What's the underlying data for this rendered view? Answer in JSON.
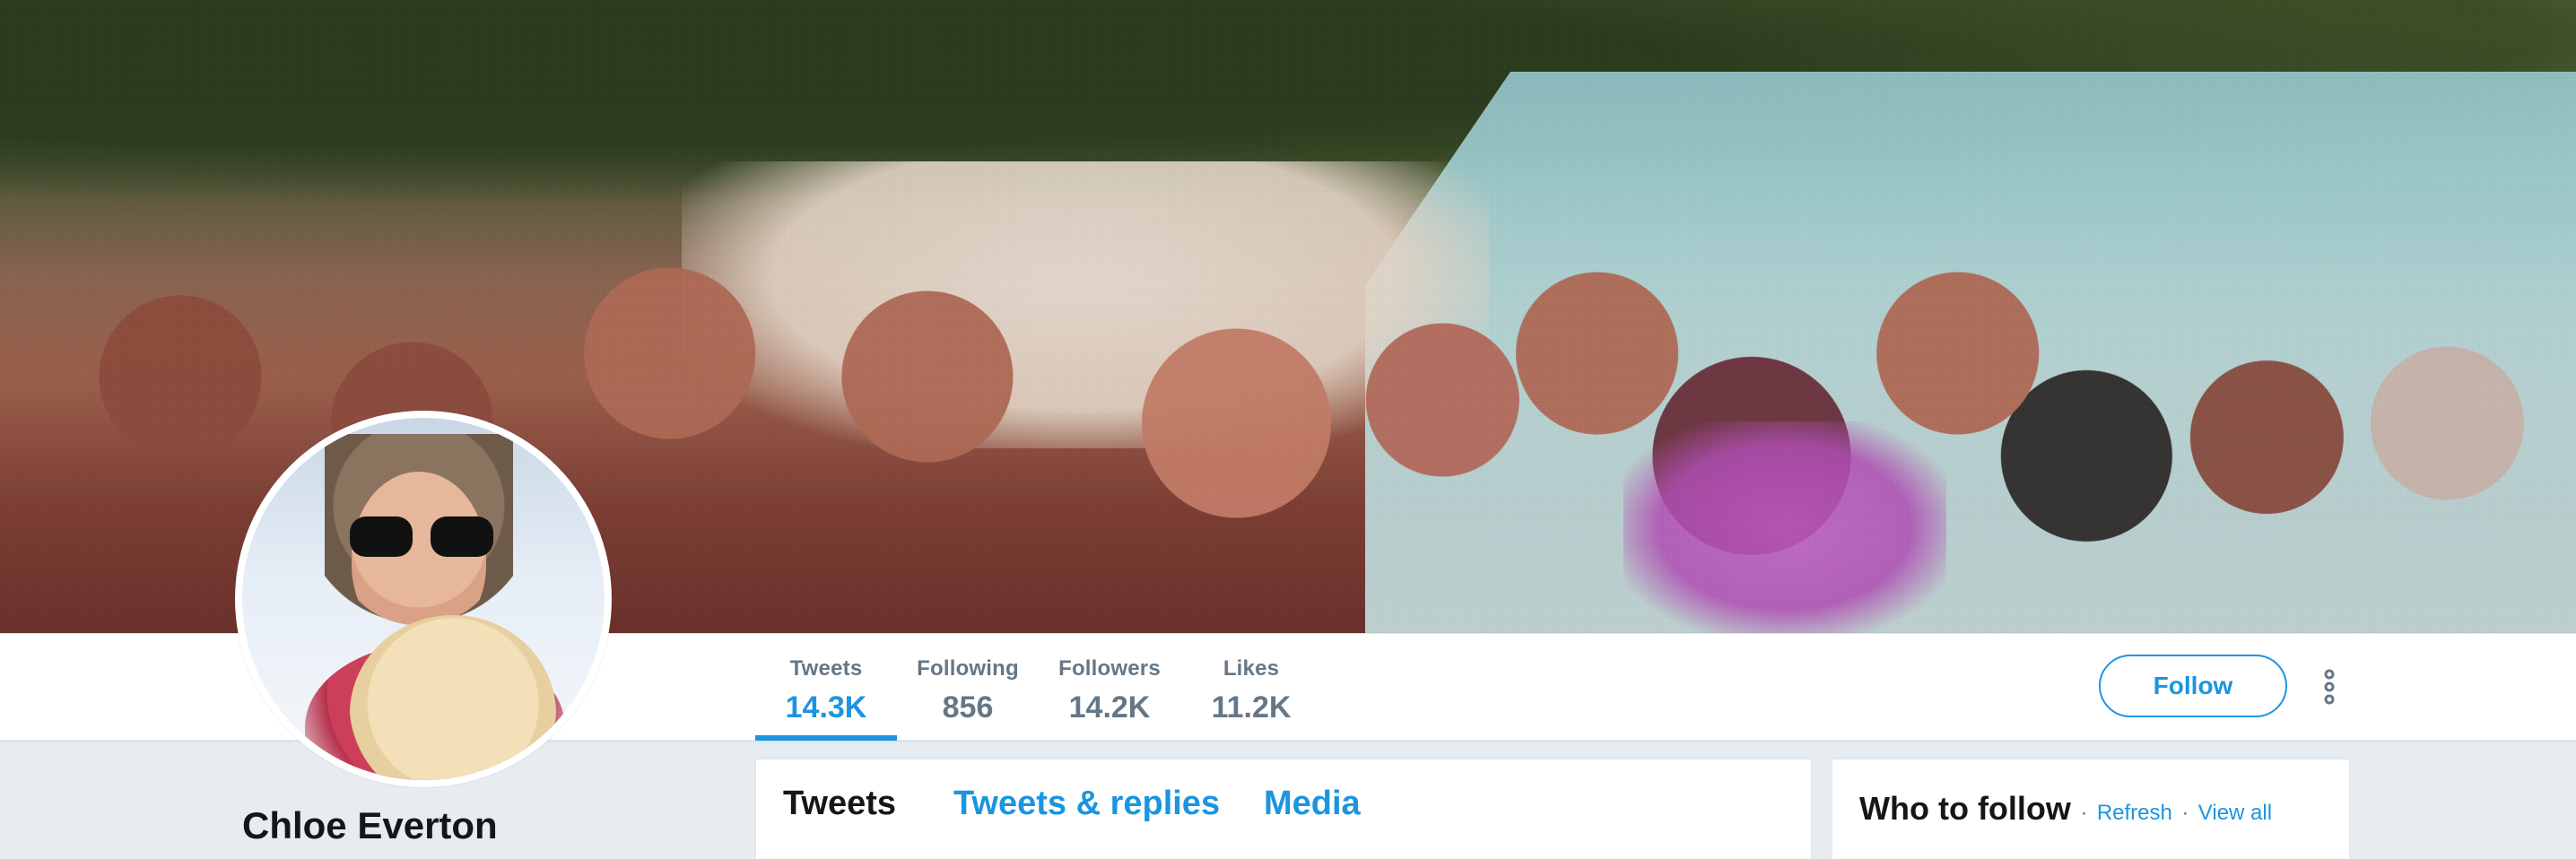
{
  "profile": {
    "name": "Chloe Everton"
  },
  "banner": {
    "description_icon": "banner-photo"
  },
  "stats": [
    {
      "label": "Tweets",
      "value": "14.3K",
      "active": true
    },
    {
      "label": "Following",
      "value": "856",
      "active": false
    },
    {
      "label": "Followers",
      "value": "14.2K",
      "active": false
    },
    {
      "label": "Likes",
      "value": "11.2K",
      "active": false
    }
  ],
  "actions": {
    "follow_label": "Follow",
    "more_icon": "vertical-dots-icon"
  },
  "tabs": [
    {
      "label": "Tweets",
      "active": true
    },
    {
      "label": "Tweets & replies",
      "active": false
    },
    {
      "label": "Media",
      "active": false
    }
  ],
  "who_to_follow": {
    "title": "Who to follow",
    "separator": "·",
    "refresh_label": "Refresh",
    "view_all_label": "View all"
  },
  "colors": {
    "accent": "#1b95e0",
    "text_primary": "#14171a",
    "text_secondary": "#657786",
    "page_bg": "#e6ecf0"
  }
}
